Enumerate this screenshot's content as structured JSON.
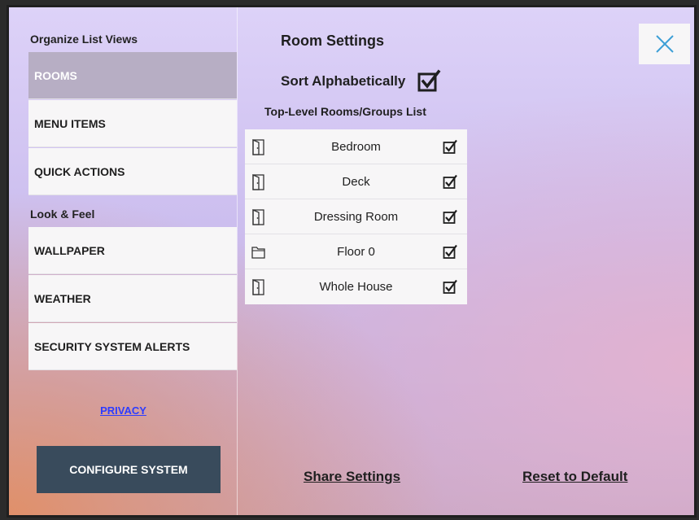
{
  "sidebar": {
    "section_organize": "Organize List Views",
    "organize_items": [
      {
        "label": "ROOMS"
      },
      {
        "label": "MENU ITEMS"
      },
      {
        "label": "QUICK ACTIONS"
      }
    ],
    "section_look": "Look & Feel",
    "look_items": [
      {
        "label": "WALLPAPER"
      },
      {
        "label": "WEATHER"
      },
      {
        "label": "SECURITY SYSTEM ALERTS"
      }
    ],
    "privacy_label": "PRIVACY",
    "configure_label": "CONFIGURE SYSTEM",
    "active_item": "ROOMS"
  },
  "main": {
    "title": "Room Settings",
    "sort_label": "Sort Alphabetically",
    "sort_checked": true,
    "list_title": "Top-Level Rooms/Groups List",
    "rooms": [
      {
        "name": "Bedroom",
        "icon": "door-icon",
        "checked": true
      },
      {
        "name": "Deck",
        "icon": "door-icon",
        "checked": true
      },
      {
        "name": "Dressing Room",
        "icon": "door-icon",
        "checked": true
      },
      {
        "name": "Floor 0",
        "icon": "folder-icon",
        "checked": true
      },
      {
        "name": "Whole House",
        "icon": "door-icon",
        "checked": true
      }
    ],
    "share_label": "Share Settings",
    "reset_label": "Reset to Default"
  },
  "colors": {
    "accent_active": "#b7aec4",
    "configure_button": "#394b5c",
    "link": "#2d3cff",
    "close_icon": "#3d9fd6"
  }
}
